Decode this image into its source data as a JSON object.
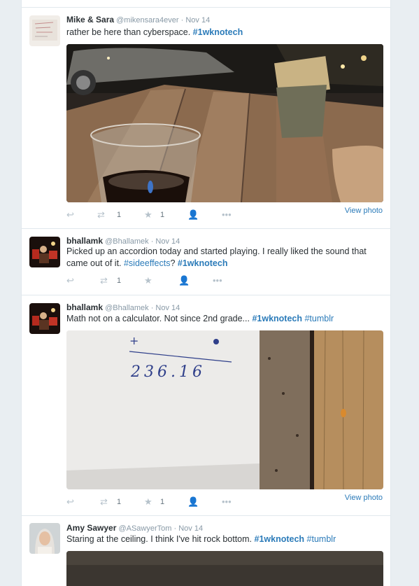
{
  "tweets": [
    {
      "name": "Mike & Sara",
      "handle": "@mikensara4ever",
      "dot": "·",
      "time": "Nov 14",
      "text_plain": "rather be here than cyberspace.  ",
      "hashtags": [
        "#1wknotech"
      ],
      "retweets": "1",
      "favorites": "1",
      "view_photo": "View photo"
    },
    {
      "name": "bhallamk",
      "handle": "@Bhallamek",
      "dot": "·",
      "time": "Nov 14",
      "text_plain": "Picked up an accordion today and started playing. I really liked the sound that came out of it. ",
      "hashtags": [
        "#sideeffects",
        "#1wknotech"
      ],
      "hashtag_sep": "?  ",
      "retweets": "1",
      "favorites": ""
    },
    {
      "name": "bhallamk",
      "handle": "@Bhallamek",
      "dot": "·",
      "time": "Nov 14",
      "text_plain": "Math not on a calculator. Not since 2nd grade... ",
      "hashtags": [
        "#1wknotech",
        "#tumblr"
      ],
      "retweets": "1",
      "favorites": "1",
      "view_photo": "View photo",
      "photo_text": "236.16",
      "photo_mark": "+"
    },
    {
      "name": "Amy Sawyer",
      "handle": "@ASawyerTom",
      "dot": "·",
      "time": "Nov 14",
      "text_plain": "Staring at the ceiling. I think I've hit rock bottom. ",
      "hashtags": [
        "#1wknotech",
        "#tumblr"
      ]
    }
  ],
  "icons": [
    "reply-icon",
    "retweet-icon",
    "favorite-icon",
    "follow-icon",
    "more-icon"
  ],
  "colors": {
    "link": "#2b7bb9",
    "name": "#292f33",
    "meta": "#8899a6",
    "action": "#b6c2cb",
    "border": "#e1e8ed",
    "bg": "#e9eef2"
  }
}
